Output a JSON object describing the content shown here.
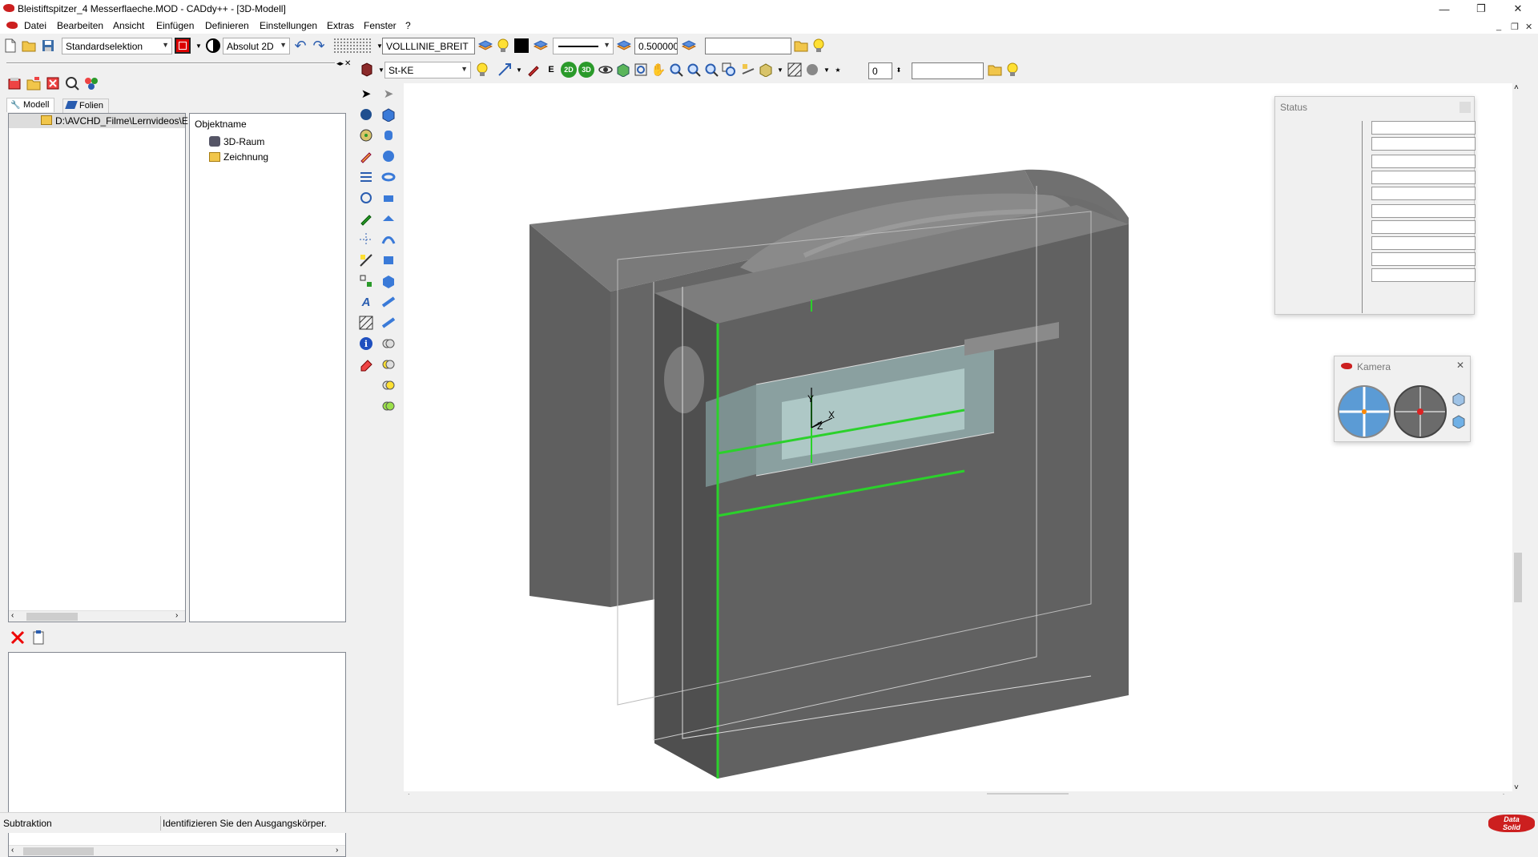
{
  "window": {
    "title": "Bleistiftspitzer_4 Messerflaeche.MOD  -  CADdy++ - [3D-Modell]",
    "minimize": "—",
    "restore": "❐",
    "close": "✕",
    "accent": "#cc1f1f"
  },
  "menu": {
    "items": [
      "Datei",
      "Bearbeiten",
      "Ansicht",
      "Einfügen",
      "Definieren",
      "Einstellungen",
      "Extras",
      "Fenster",
      "?"
    ],
    "mdi": {
      "minimize": "_",
      "restore": "❐",
      "close": "✕"
    }
  },
  "toolbar1": {
    "selection_mode": "Standardselektion",
    "coord_mode": "Absolut 2D",
    "line_type": "VOLLLINIE_BREIT",
    "line_width": "0.500000",
    "empty_field": ""
  },
  "toolbar2": {
    "material": "St-KE",
    "btn_2d": "2D",
    "btn_3d": "3D",
    "counter": "0",
    "empty_field": ""
  },
  "left_panel": {
    "tabs": [
      "Modell",
      "Folien"
    ],
    "path": "D:\\AVCHD_Filme\\Lernvideos\\E",
    "object_header": "Objektname",
    "objects": [
      "3D-Raum",
      "Zeichnung"
    ]
  },
  "status_window": {
    "title": "Status",
    "rows": [
      "",
      "",
      "",
      "",
      "",
      "",
      "",
      "",
      "",
      ""
    ]
  },
  "camera_window": {
    "title": "Kamera",
    "close": "✕"
  },
  "statusbar": {
    "mode": "Subtraktion",
    "prompt": "Identifizieren Sie den Ausgangskörper.",
    "logo_top": "Data",
    "logo_bottom": "Solid"
  }
}
